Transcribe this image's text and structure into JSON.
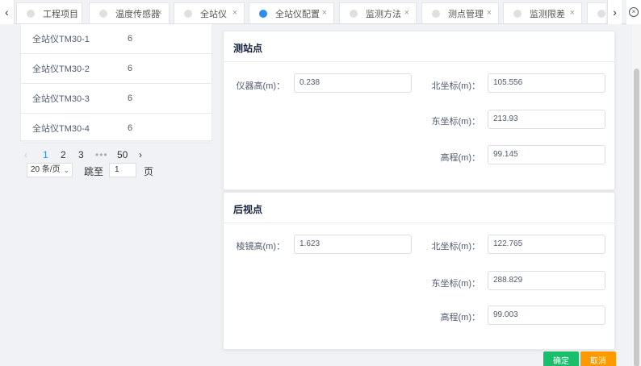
{
  "tabs": [
    {
      "label": "工程项目",
      "closable": false,
      "active": false
    },
    {
      "label": "温度传感器",
      "closable": true,
      "active": false
    },
    {
      "label": "全站仪",
      "closable": true,
      "active": false
    },
    {
      "label": "全站仪配置",
      "closable": true,
      "active": true
    },
    {
      "label": "监测方法",
      "closable": true,
      "active": false
    },
    {
      "label": "测点管理",
      "closable": true,
      "active": false
    },
    {
      "label": "监测限差",
      "closable": true,
      "active": false
    }
  ],
  "tab_close_glyph": "×",
  "device_list": [
    {
      "name": "全站仪TM30-1",
      "count": "6"
    },
    {
      "name": "全站仪TM30-2",
      "count": "6"
    },
    {
      "name": "全站仪TM30-3",
      "count": "6"
    },
    {
      "name": "全站仪TM30-4",
      "count": "6"
    }
  ],
  "pager": {
    "prev": "‹",
    "pages": [
      "1",
      "2",
      "3"
    ],
    "ellipsis": "•••",
    "last": "50",
    "next": "›",
    "page_size": "20 条/页",
    "jump_label": "跳至",
    "jump_value": "1",
    "jump_suffix": "页",
    "current_page": "1"
  },
  "station_card": {
    "title": "测站点",
    "instrument_height_label": "仪器高(m)：",
    "instrument_height_value": "0.238",
    "north_label": "北坐标(m)：",
    "north_value": "105.556",
    "east_label": "东坐标(m)：",
    "east_value": "213.93",
    "elevation_label": "高程(m)：",
    "elevation_value": "99.145"
  },
  "backsight_card": {
    "title": "后视点",
    "prism_height_label": "棱镜高(m)：",
    "prism_height_value": "1.623",
    "north_label": "北坐标(m)：",
    "north_value": "122.765",
    "east_label": "东坐标(m)：",
    "east_value": "288.829",
    "elevation_label": "高程(m)：",
    "elevation_value": "99.003"
  },
  "buttons": {
    "confirm": "确定",
    "cancel": "取消"
  },
  "colors": {
    "primary": "#2d8cf0",
    "confirm": "#19be6b",
    "cancel": "#ff9900"
  },
  "icons": {
    "scroll_left": "‹",
    "scroll_right": "›",
    "close_all": "×",
    "dropdown": "⌄"
  }
}
